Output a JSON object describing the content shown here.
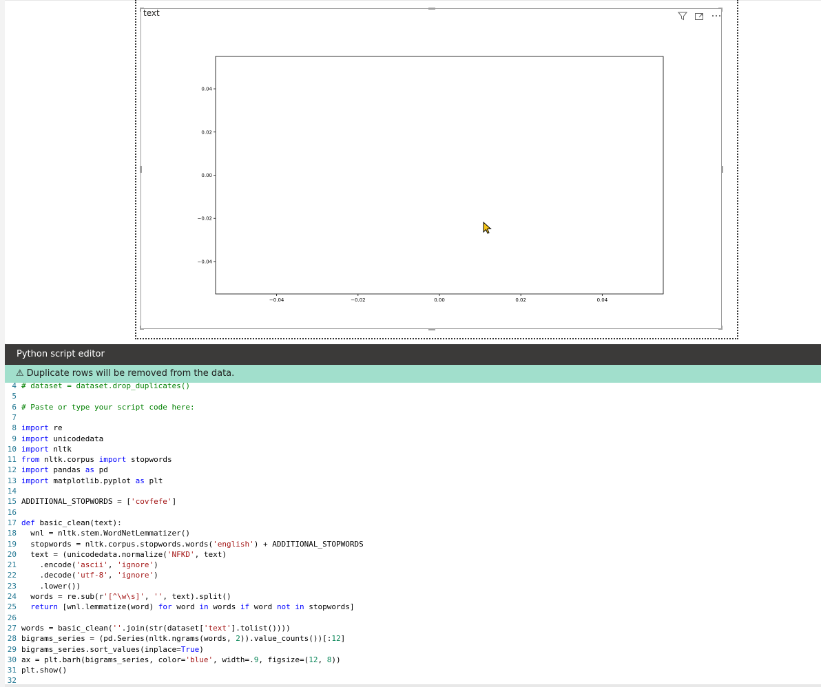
{
  "visual": {
    "title": "text",
    "header_icons": [
      "filter-icon",
      "focus-mode-icon",
      "more-options-icon"
    ]
  },
  "chart_data": {
    "type": "scatter",
    "title": "",
    "xlabel": "",
    "ylabel": "",
    "xlim": [
      -0.055,
      0.055
    ],
    "ylim": [
      -0.055,
      0.055
    ],
    "x_ticks": [
      "−0.04",
      "−0.02",
      "0.00",
      "0.02",
      "0.04"
    ],
    "x_tick_values": [
      -0.04,
      -0.02,
      0.0,
      0.02,
      0.04
    ],
    "y_ticks": [
      "0.04",
      "0.02",
      "0.00",
      "−0.02",
      "−0.04"
    ],
    "y_tick_values": [
      0.04,
      0.02,
      0.0,
      -0.02,
      -0.04
    ],
    "series": [],
    "grid": false
  },
  "editor": {
    "title": "Python script editor",
    "warning": "Duplicate rows will be removed from the data.",
    "lines": [
      {
        "n": "4",
        "tokens": [
          [
            "com",
            "# dataset = dataset.drop_duplicates()"
          ]
        ]
      },
      {
        "n": "5",
        "tokens": []
      },
      {
        "n": "6",
        "tokens": [
          [
            "com",
            "# Paste or type your script code here:"
          ]
        ]
      },
      {
        "n": "7",
        "tokens": []
      },
      {
        "n": "8",
        "tokens": [
          [
            "kw",
            "import"
          ],
          [
            "plain",
            " re"
          ]
        ]
      },
      {
        "n": "9",
        "tokens": [
          [
            "kw",
            "import"
          ],
          [
            "plain",
            " unicodedata"
          ]
        ]
      },
      {
        "n": "10",
        "tokens": [
          [
            "kw",
            "import"
          ],
          [
            "plain",
            " nltk"
          ]
        ]
      },
      {
        "n": "11",
        "tokens": [
          [
            "kw",
            "from"
          ],
          [
            "plain",
            " nltk.corpus "
          ],
          [
            "kw",
            "import"
          ],
          [
            "plain",
            " stopwords"
          ]
        ]
      },
      {
        "n": "12",
        "tokens": [
          [
            "kw",
            "import"
          ],
          [
            "plain",
            " pandas "
          ],
          [
            "kw",
            "as"
          ],
          [
            "plain",
            " pd"
          ]
        ]
      },
      {
        "n": "13",
        "tokens": [
          [
            "kw",
            "import"
          ],
          [
            "plain",
            " matplotlib.pyplot "
          ],
          [
            "kw",
            "as"
          ],
          [
            "plain",
            " plt"
          ]
        ]
      },
      {
        "n": "14",
        "tokens": []
      },
      {
        "n": "15",
        "tokens": [
          [
            "plain",
            "ADDITIONAL_STOPWORDS = ["
          ],
          [
            "str",
            "'covfefe'"
          ],
          [
            "plain",
            "]"
          ]
        ]
      },
      {
        "n": "16",
        "tokens": []
      },
      {
        "n": "17",
        "tokens": [
          [
            "kw",
            "def"
          ],
          [
            "plain",
            " basic_clean(text):"
          ]
        ]
      },
      {
        "n": "18",
        "tokens": [
          [
            "plain",
            "  wnl = nltk.stem.WordNetLemmatizer()"
          ]
        ]
      },
      {
        "n": "19",
        "tokens": [
          [
            "plain",
            "  stopwords = nltk.corpus.stopwords.words("
          ],
          [
            "str",
            "'english'"
          ],
          [
            "plain",
            ") + ADDITIONAL_STOPWORDS"
          ]
        ]
      },
      {
        "n": "20",
        "tokens": [
          [
            "plain",
            "  text = (unicodedata.normalize("
          ],
          [
            "str",
            "'NFKD'"
          ],
          [
            "plain",
            ", text)"
          ]
        ]
      },
      {
        "n": "21",
        "tokens": [
          [
            "plain",
            "    .encode("
          ],
          [
            "str",
            "'ascii'"
          ],
          [
            "plain",
            ", "
          ],
          [
            "str",
            "'ignore'"
          ],
          [
            "plain",
            ")"
          ]
        ]
      },
      {
        "n": "22",
        "tokens": [
          [
            "plain",
            "    .decode("
          ],
          [
            "str",
            "'utf-8'"
          ],
          [
            "plain",
            ", "
          ],
          [
            "str",
            "'ignore'"
          ],
          [
            "plain",
            ")"
          ]
        ]
      },
      {
        "n": "23",
        "tokens": [
          [
            "plain",
            "    .lower())"
          ]
        ]
      },
      {
        "n": "24",
        "tokens": [
          [
            "plain",
            "  words = re.sub(r"
          ],
          [
            "str",
            "'[^\\w\\s]'"
          ],
          [
            "plain",
            ", "
          ],
          [
            "str",
            "''"
          ],
          [
            "plain",
            ", text).split()"
          ]
        ]
      },
      {
        "n": "25",
        "tokens": [
          [
            "plain",
            "  "
          ],
          [
            "kw",
            "return"
          ],
          [
            "plain",
            " [wnl.lemmatize(word) "
          ],
          [
            "kw",
            "for"
          ],
          [
            "plain",
            " word "
          ],
          [
            "kw",
            "in"
          ],
          [
            "plain",
            " words "
          ],
          [
            "kw",
            "if"
          ],
          [
            "plain",
            " word "
          ],
          [
            "kw",
            "not in"
          ],
          [
            "plain",
            " stopwords]"
          ]
        ]
      },
      {
        "n": "26",
        "tokens": []
      },
      {
        "n": "27",
        "tokens": [
          [
            "plain",
            "words = basic_clean("
          ],
          [
            "str",
            "''"
          ],
          [
            "plain",
            ".join(str(dataset["
          ],
          [
            "str",
            "'text'"
          ],
          [
            "plain",
            "].tolist())))"
          ]
        ]
      },
      {
        "n": "28",
        "tokens": [
          [
            "plain",
            "bigrams_series = (pd.Series(nltk.ngrams(words, "
          ],
          [
            "num",
            "2"
          ],
          [
            "plain",
            ")).value_counts())[:"
          ],
          [
            "num",
            "12"
          ],
          [
            "plain",
            "]"
          ]
        ]
      },
      {
        "n": "29",
        "tokens": [
          [
            "plain",
            "bigrams_series.sort_values(inplace="
          ],
          [
            "kw",
            "True"
          ],
          [
            "plain",
            ")"
          ]
        ]
      },
      {
        "n": "30",
        "tokens": [
          [
            "plain",
            "ax = plt.barh(bigrams_series, color="
          ],
          [
            "str",
            "'blue'"
          ],
          [
            "plain",
            ", width=."
          ],
          [
            "num",
            "9"
          ],
          [
            "plain",
            ", figsize=("
          ],
          [
            "num",
            "12"
          ],
          [
            "plain",
            ", "
          ],
          [
            "num",
            "8"
          ],
          [
            "plain",
            "))"
          ]
        ]
      },
      {
        "n": "31",
        "tokens": [
          [
            "plain",
            "plt.show()"
          ]
        ]
      },
      {
        "n": "32",
        "tokens": []
      }
    ]
  }
}
